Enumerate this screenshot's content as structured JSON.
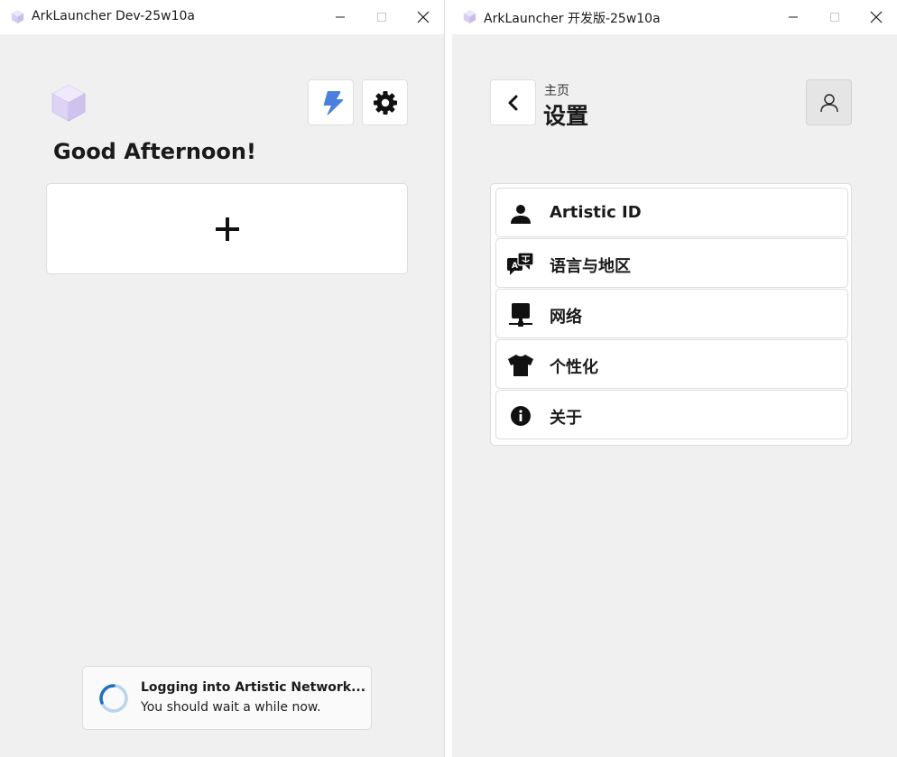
{
  "left_window": {
    "title": "ArkLauncher Dev-25w10a",
    "greeting": "Good Afternoon!",
    "add_card_label": "+",
    "toast": {
      "title": "Logging into Artistic Network...",
      "body": "You should wait a while now."
    }
  },
  "right_window": {
    "title": "ArkLauncher 开发版-25w10a",
    "breadcrumb": "主页",
    "page_title": "设置",
    "settings_items": [
      {
        "label": "Artistic ID",
        "icon": "person-icon"
      },
      {
        "label": "语言与地区",
        "icon": "translate-icon"
      },
      {
        "label": "网络",
        "icon": "network-icon"
      },
      {
        "label": "个性化",
        "icon": "shirt-icon"
      },
      {
        "label": "关于",
        "icon": "info-icon"
      }
    ]
  },
  "colors": {
    "window_bg": "#f0f0f0",
    "card_bg": "#ffffff",
    "accent_bolt": "#4a7fe0",
    "spinner": "#1f6fc4"
  }
}
